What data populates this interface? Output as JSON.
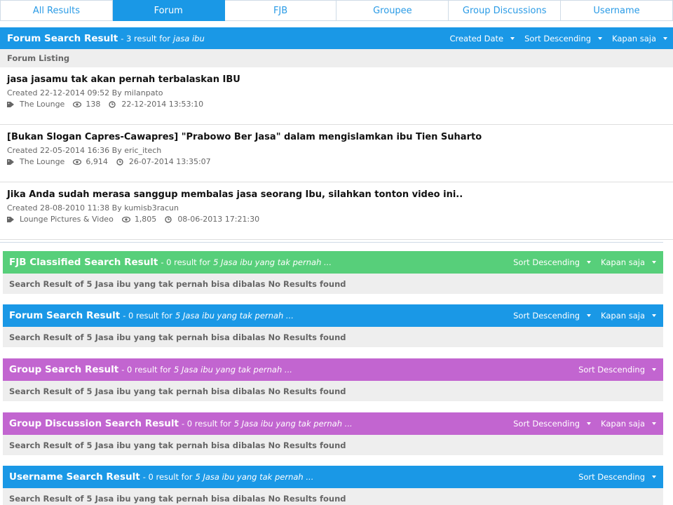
{
  "tabs": [
    "All Results",
    "Forum",
    "FJB",
    "Groupee",
    "Group Discussions",
    "Username"
  ],
  "active_tab": "Forum",
  "forum": {
    "title": "Forum Search Result",
    "count_text": "- 3 result for",
    "query": "jasa ibu",
    "controls": [
      "Created Date",
      "Sort Descending",
      "Kapan saja"
    ],
    "listing_label": "Forum Listing",
    "items": [
      {
        "title": "jasa jasamu tak akan pernah terbalaskan IBU",
        "created": "Created 22-12-2014 09:52 By milanpato",
        "category": "The Lounge",
        "views": "138",
        "last": "22-12-2014 13:53:10"
      },
      {
        "title": "[Bukan Slogan Capres-Cawapres] \"Prabowo Ber Jasa\" dalam mengislamkan ibu Tien Suharto",
        "created": "Created 22-05-2014 16:36 By eric_itech",
        "category": "The Lounge",
        "views": "6,914",
        "last": "26-07-2014 13:35:07"
      },
      {
        "title": "Jika Anda sudah merasa sanggup membalas jasa seorang Ibu, silahkan tonton video ini..",
        "created": "Created 28-08-2010 11:38 By kumisb3racun",
        "category": "Lounge Pictures & Video",
        "views": "1,805",
        "last": "08-06-2013 17:21:30"
      }
    ]
  },
  "sections": [
    {
      "title": "FJB Classified Search Result",
      "count_text": "- 0 result for",
      "query": "5 Jasa ibu yang tak pernah ...",
      "controls": [
        "Sort Descending",
        "Kapan saja"
      ],
      "body": "Search Result of 5 Jasa ibu yang tak pernah bisa dibalas No Results found",
      "color": "#57cf7a"
    },
    {
      "title": "Forum Search Result",
      "count_text": "- 0 result for",
      "query": "5 Jasa ibu yang tak pernah ...",
      "controls": [
        "Sort Descending",
        "Kapan saja"
      ],
      "body": "Search Result of 5 Jasa ibu yang tak pernah bisa dibalas No Results found",
      "color": "#1a98e6"
    },
    {
      "title": "Group Search Result",
      "count_text": "- 0 result for",
      "query": "5 Jasa ibu yang tak pernah ...",
      "controls": [
        "Sort Descending"
      ],
      "body": "Search Result of 5 Jasa ibu yang tak pernah bisa dibalas No Results found",
      "color": "#c265d0"
    },
    {
      "title": "Group Discussion Search Result",
      "count_text": "- 0 result for",
      "query": "5 Jasa ibu yang tak pernah ...",
      "controls": [
        "Sort Descending",
        "Kapan saja"
      ],
      "body": "Search Result of 5 Jasa ibu yang tak pernah bisa dibalas No Results found",
      "color": "#c265d0"
    },
    {
      "title": "Username Search Result",
      "count_text": "- 0 result for",
      "query": "5 Jasa ibu yang tak pernah ...",
      "controls": [
        "Sort Descending"
      ],
      "body": "Search Result of 5 Jasa ibu yang tak pernah bisa dibalas No Results found",
      "color": "#1a98e6"
    }
  ]
}
